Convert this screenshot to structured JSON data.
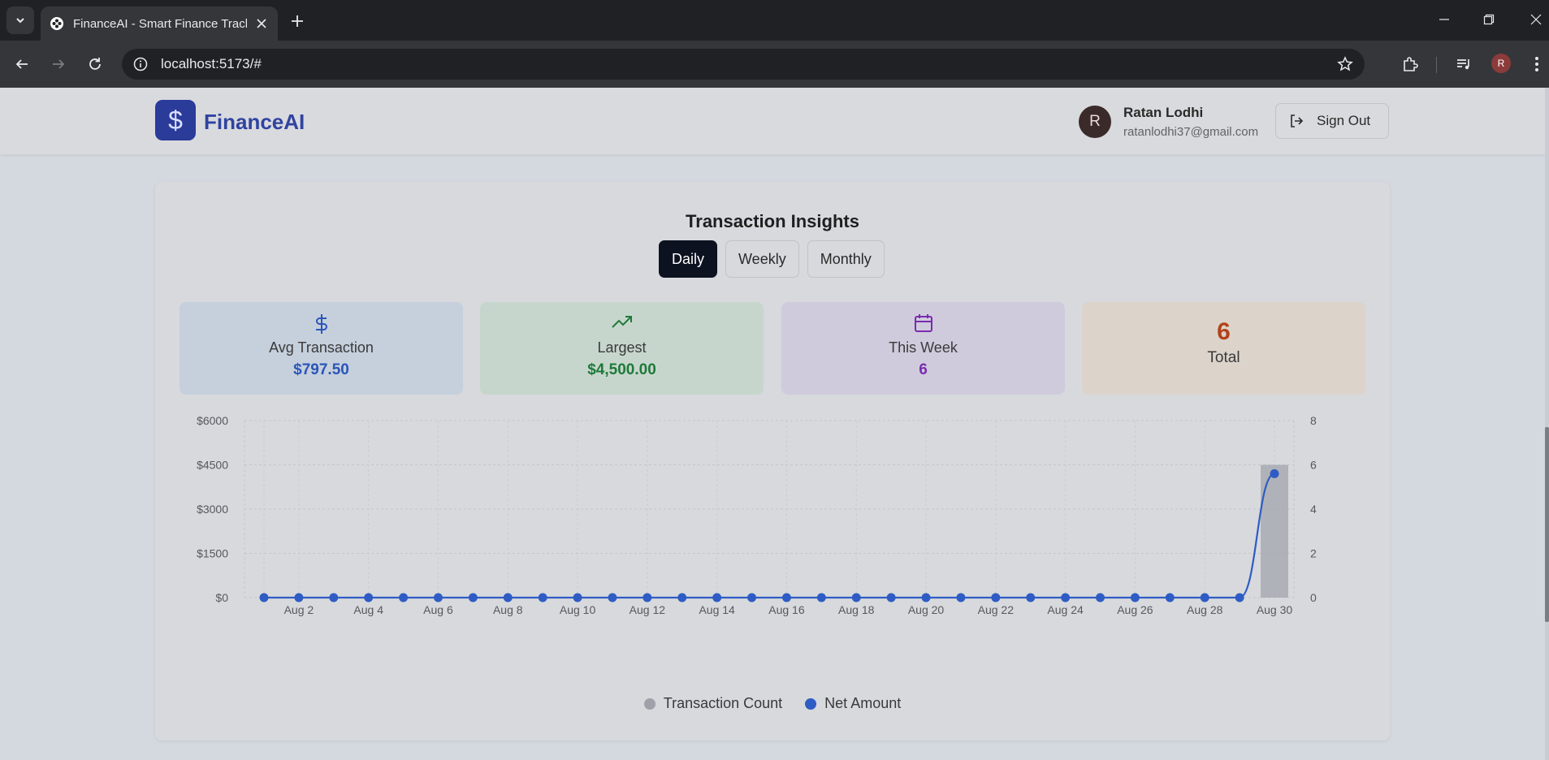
{
  "browser": {
    "tab_title": "FinanceAI - Smart Finance Track",
    "url": "localhost:5173/#",
    "profile_initial": "R"
  },
  "header": {
    "logo_symbol": "$",
    "app_name": "FinanceAI",
    "user_initial": "R",
    "user_name": "Ratan Lodhi",
    "user_email": "ratanlodhi37@gmail.com",
    "signout_label": "Sign Out"
  },
  "insights": {
    "title": "Transaction Insights",
    "tabs": [
      {
        "label": "Daily",
        "active": true
      },
      {
        "label": "Weekly",
        "active": false
      },
      {
        "label": "Monthly",
        "active": false
      }
    ],
    "stats": [
      {
        "label": "Avg Transaction",
        "value": "$797.50",
        "icon": "dollar-icon",
        "color": "#2a56b8"
      },
      {
        "label": "Largest",
        "value": "$4,500.00",
        "icon": "trending-up-icon",
        "color": "#1d7a3a"
      },
      {
        "label": "This Week",
        "value": "6",
        "icon": "calendar-icon",
        "color": "#7a2cb0"
      },
      {
        "label": "Total",
        "value": "6",
        "color": "#b3421a"
      }
    ]
  },
  "chart_data": {
    "type": "line",
    "x_tick_labels": [
      "Aug 2",
      "Aug 4",
      "Aug 6",
      "Aug 8",
      "Aug 10",
      "Aug 12",
      "Aug 14",
      "Aug 16",
      "Aug 18",
      "Aug 20",
      "Aug 22",
      "Aug 24",
      "Aug 26",
      "Aug 28",
      "Aug 30"
    ],
    "y_left_ticks": [
      "$0",
      "$1500",
      "$3000",
      "$4500",
      "$6000"
    ],
    "y_left_lim": [
      0,
      6000
    ],
    "y_right_ticks": [
      "0",
      "2",
      "4",
      "6",
      "8"
    ],
    "y_right_lim": [
      0,
      8
    ],
    "grid": true,
    "legend_position": "bottom-center",
    "categories": [
      "Aug 1",
      "Aug 2",
      "Aug 3",
      "Aug 4",
      "Aug 5",
      "Aug 6",
      "Aug 7",
      "Aug 8",
      "Aug 9",
      "Aug 10",
      "Aug 11",
      "Aug 12",
      "Aug 13",
      "Aug 14",
      "Aug 15",
      "Aug 16",
      "Aug 17",
      "Aug 18",
      "Aug 19",
      "Aug 20",
      "Aug 21",
      "Aug 22",
      "Aug 23",
      "Aug 24",
      "Aug 25",
      "Aug 26",
      "Aug 27",
      "Aug 28",
      "Aug 29",
      "Aug 30"
    ],
    "series": [
      {
        "name": "Transaction Count",
        "type": "bar",
        "axis": "right",
        "color": "#9ea1a8",
        "values": [
          0,
          0,
          0,
          0,
          0,
          0,
          0,
          0,
          0,
          0,
          0,
          0,
          0,
          0,
          0,
          0,
          0,
          0,
          0,
          0,
          0,
          0,
          0,
          0,
          0,
          0,
          0,
          0,
          0,
          6
        ]
      },
      {
        "name": "Net Amount",
        "type": "line",
        "axis": "left",
        "color": "#2f5cc4",
        "values": [
          0,
          0,
          0,
          0,
          0,
          0,
          0,
          0,
          0,
          0,
          0,
          0,
          0,
          0,
          0,
          0,
          0,
          0,
          0,
          0,
          0,
          0,
          0,
          0,
          0,
          0,
          0,
          0,
          0,
          4200
        ]
      }
    ]
  }
}
